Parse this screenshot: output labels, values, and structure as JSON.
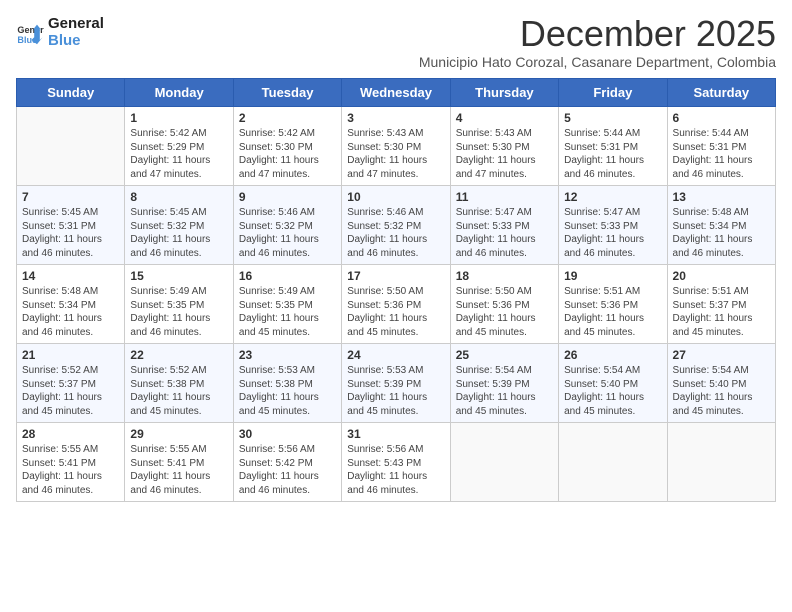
{
  "logo": {
    "line1": "General",
    "line2": "Blue"
  },
  "title": {
    "month_year": "December 2025",
    "location": "Municipio Hato Corozal, Casanare Department, Colombia"
  },
  "days_of_week": [
    "Sunday",
    "Monday",
    "Tuesday",
    "Wednesday",
    "Thursday",
    "Friday",
    "Saturday"
  ],
  "weeks": [
    [
      {
        "day": "",
        "content": ""
      },
      {
        "day": "1",
        "content": "Sunrise: 5:42 AM\nSunset: 5:29 PM\nDaylight: 11 hours\nand 47 minutes."
      },
      {
        "day": "2",
        "content": "Sunrise: 5:42 AM\nSunset: 5:30 PM\nDaylight: 11 hours\nand 47 minutes."
      },
      {
        "day": "3",
        "content": "Sunrise: 5:43 AM\nSunset: 5:30 PM\nDaylight: 11 hours\nand 47 minutes."
      },
      {
        "day": "4",
        "content": "Sunrise: 5:43 AM\nSunset: 5:30 PM\nDaylight: 11 hours\nand 47 minutes."
      },
      {
        "day": "5",
        "content": "Sunrise: 5:44 AM\nSunset: 5:31 PM\nDaylight: 11 hours\nand 46 minutes."
      },
      {
        "day": "6",
        "content": "Sunrise: 5:44 AM\nSunset: 5:31 PM\nDaylight: 11 hours\nand 46 minutes."
      }
    ],
    [
      {
        "day": "7",
        "content": "Sunrise: 5:45 AM\nSunset: 5:31 PM\nDaylight: 11 hours\nand 46 minutes."
      },
      {
        "day": "8",
        "content": "Sunrise: 5:45 AM\nSunset: 5:32 PM\nDaylight: 11 hours\nand 46 minutes."
      },
      {
        "day": "9",
        "content": "Sunrise: 5:46 AM\nSunset: 5:32 PM\nDaylight: 11 hours\nand 46 minutes."
      },
      {
        "day": "10",
        "content": "Sunrise: 5:46 AM\nSunset: 5:32 PM\nDaylight: 11 hours\nand 46 minutes."
      },
      {
        "day": "11",
        "content": "Sunrise: 5:47 AM\nSunset: 5:33 PM\nDaylight: 11 hours\nand 46 minutes."
      },
      {
        "day": "12",
        "content": "Sunrise: 5:47 AM\nSunset: 5:33 PM\nDaylight: 11 hours\nand 46 minutes."
      },
      {
        "day": "13",
        "content": "Sunrise: 5:48 AM\nSunset: 5:34 PM\nDaylight: 11 hours\nand 46 minutes."
      }
    ],
    [
      {
        "day": "14",
        "content": "Sunrise: 5:48 AM\nSunset: 5:34 PM\nDaylight: 11 hours\nand 46 minutes."
      },
      {
        "day": "15",
        "content": "Sunrise: 5:49 AM\nSunset: 5:35 PM\nDaylight: 11 hours\nand 46 minutes."
      },
      {
        "day": "16",
        "content": "Sunrise: 5:49 AM\nSunset: 5:35 PM\nDaylight: 11 hours\nand 45 minutes."
      },
      {
        "day": "17",
        "content": "Sunrise: 5:50 AM\nSunset: 5:36 PM\nDaylight: 11 hours\nand 45 minutes."
      },
      {
        "day": "18",
        "content": "Sunrise: 5:50 AM\nSunset: 5:36 PM\nDaylight: 11 hours\nand 45 minutes."
      },
      {
        "day": "19",
        "content": "Sunrise: 5:51 AM\nSunset: 5:36 PM\nDaylight: 11 hours\nand 45 minutes."
      },
      {
        "day": "20",
        "content": "Sunrise: 5:51 AM\nSunset: 5:37 PM\nDaylight: 11 hours\nand 45 minutes."
      }
    ],
    [
      {
        "day": "21",
        "content": "Sunrise: 5:52 AM\nSunset: 5:37 PM\nDaylight: 11 hours\nand 45 minutes."
      },
      {
        "day": "22",
        "content": "Sunrise: 5:52 AM\nSunset: 5:38 PM\nDaylight: 11 hours\nand 45 minutes."
      },
      {
        "day": "23",
        "content": "Sunrise: 5:53 AM\nSunset: 5:38 PM\nDaylight: 11 hours\nand 45 minutes."
      },
      {
        "day": "24",
        "content": "Sunrise: 5:53 AM\nSunset: 5:39 PM\nDaylight: 11 hours\nand 45 minutes."
      },
      {
        "day": "25",
        "content": "Sunrise: 5:54 AM\nSunset: 5:39 PM\nDaylight: 11 hours\nand 45 minutes."
      },
      {
        "day": "26",
        "content": "Sunrise: 5:54 AM\nSunset: 5:40 PM\nDaylight: 11 hours\nand 45 minutes."
      },
      {
        "day": "27",
        "content": "Sunrise: 5:54 AM\nSunset: 5:40 PM\nDaylight: 11 hours\nand 45 minutes."
      }
    ],
    [
      {
        "day": "28",
        "content": "Sunrise: 5:55 AM\nSunset: 5:41 PM\nDaylight: 11 hours\nand 46 minutes."
      },
      {
        "day": "29",
        "content": "Sunrise: 5:55 AM\nSunset: 5:41 PM\nDaylight: 11 hours\nand 46 minutes."
      },
      {
        "day": "30",
        "content": "Sunrise: 5:56 AM\nSunset: 5:42 PM\nDaylight: 11 hours\nand 46 minutes."
      },
      {
        "day": "31",
        "content": "Sunrise: 5:56 AM\nSunset: 5:43 PM\nDaylight: 11 hours\nand 46 minutes."
      },
      {
        "day": "",
        "content": ""
      },
      {
        "day": "",
        "content": ""
      },
      {
        "day": "",
        "content": ""
      }
    ]
  ]
}
